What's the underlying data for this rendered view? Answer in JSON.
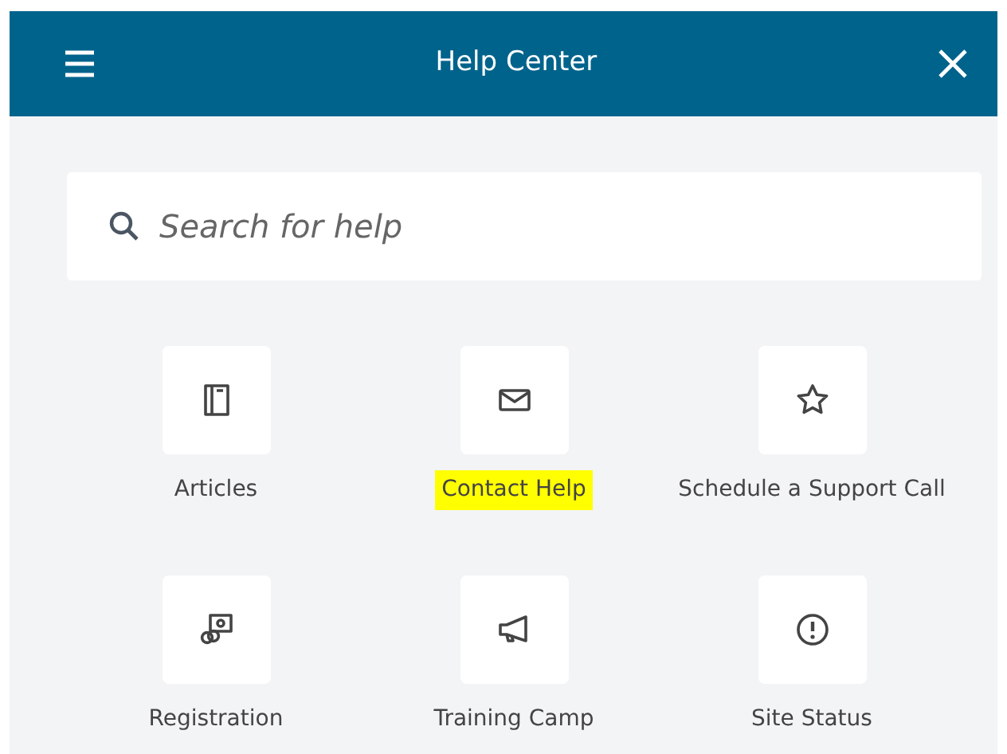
{
  "header": {
    "title": "Help Center"
  },
  "search": {
    "placeholder": "Search for help"
  },
  "tiles": [
    {
      "label": "Articles",
      "highlighted": false
    },
    {
      "label": "Contact Help",
      "highlighted": true
    },
    {
      "label": "Schedule a Support Call",
      "highlighted": false
    },
    {
      "label": "Registration",
      "highlighted": false
    },
    {
      "label": "Training Camp",
      "highlighted": false
    },
    {
      "label": "Site Status",
      "highlighted": false
    }
  ]
}
